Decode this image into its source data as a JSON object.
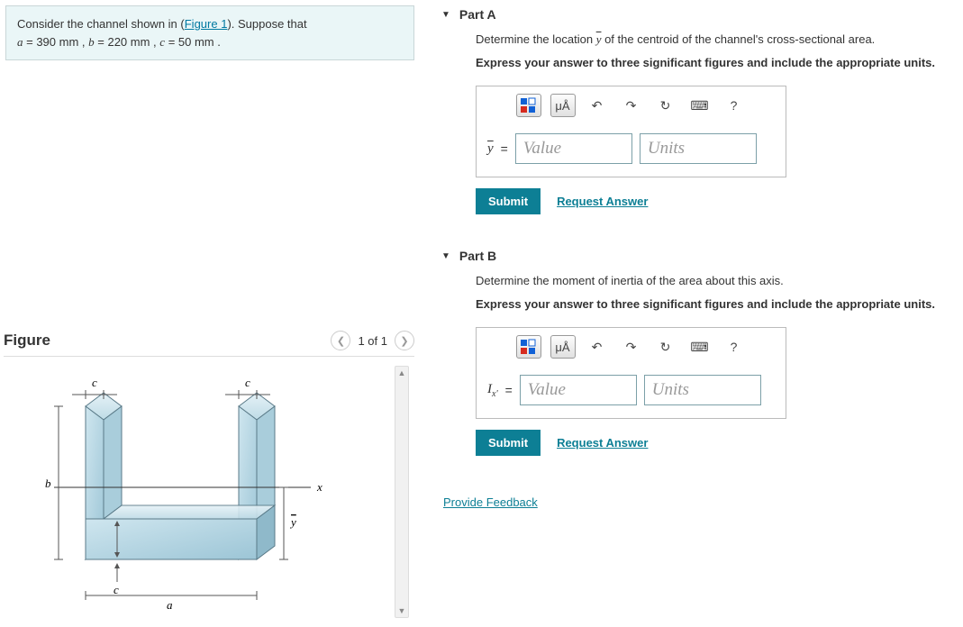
{
  "problem": {
    "prefix": "Consider the channel shown in (",
    "figure_link": "Figure 1",
    "suffix": "). Suppose that ",
    "params_line": "a = 390  mm , b = 220  mm , c = 50  mm .",
    "a_var": "a",
    "a_val": "= 390  mm ,",
    "b_var": "b",
    "b_val": "= 220  mm ,",
    "c_var": "c",
    "c_val": "= 50  mm ."
  },
  "figure": {
    "title": "Figure",
    "pager": "1 of 1",
    "labels": {
      "a": "a",
      "b": "b",
      "c": "c",
      "x": "x",
      "y": "y",
      "ybar": "y"
    }
  },
  "partA": {
    "title": "Part A",
    "prompt_prefix": "Determine the location ",
    "prompt_var": "ȳ",
    "prompt_suffix": " of the centroid of the channel's cross-sectional area.",
    "instr": "Express your answer to three significant figures and include the appropriate units.",
    "var_label": "ȳ",
    "value_ph": "Value",
    "units_ph": "Units",
    "submit": "Submit",
    "request": "Request Answer",
    "mu": "μÅ",
    "help": "?"
  },
  "partB": {
    "title": "Part B",
    "prompt": "Determine the moment of inertia of the area about this axis.",
    "instr": "Express your answer to three significant figures and include the appropriate units.",
    "var_label_html": "I_x'",
    "var_I": "I",
    "var_sub": "x'",
    "value_ph": "Value",
    "units_ph": "Units",
    "submit": "Submit",
    "request": "Request Answer",
    "mu": "μÅ",
    "help": "?"
  },
  "feedback": "Provide Feedback"
}
